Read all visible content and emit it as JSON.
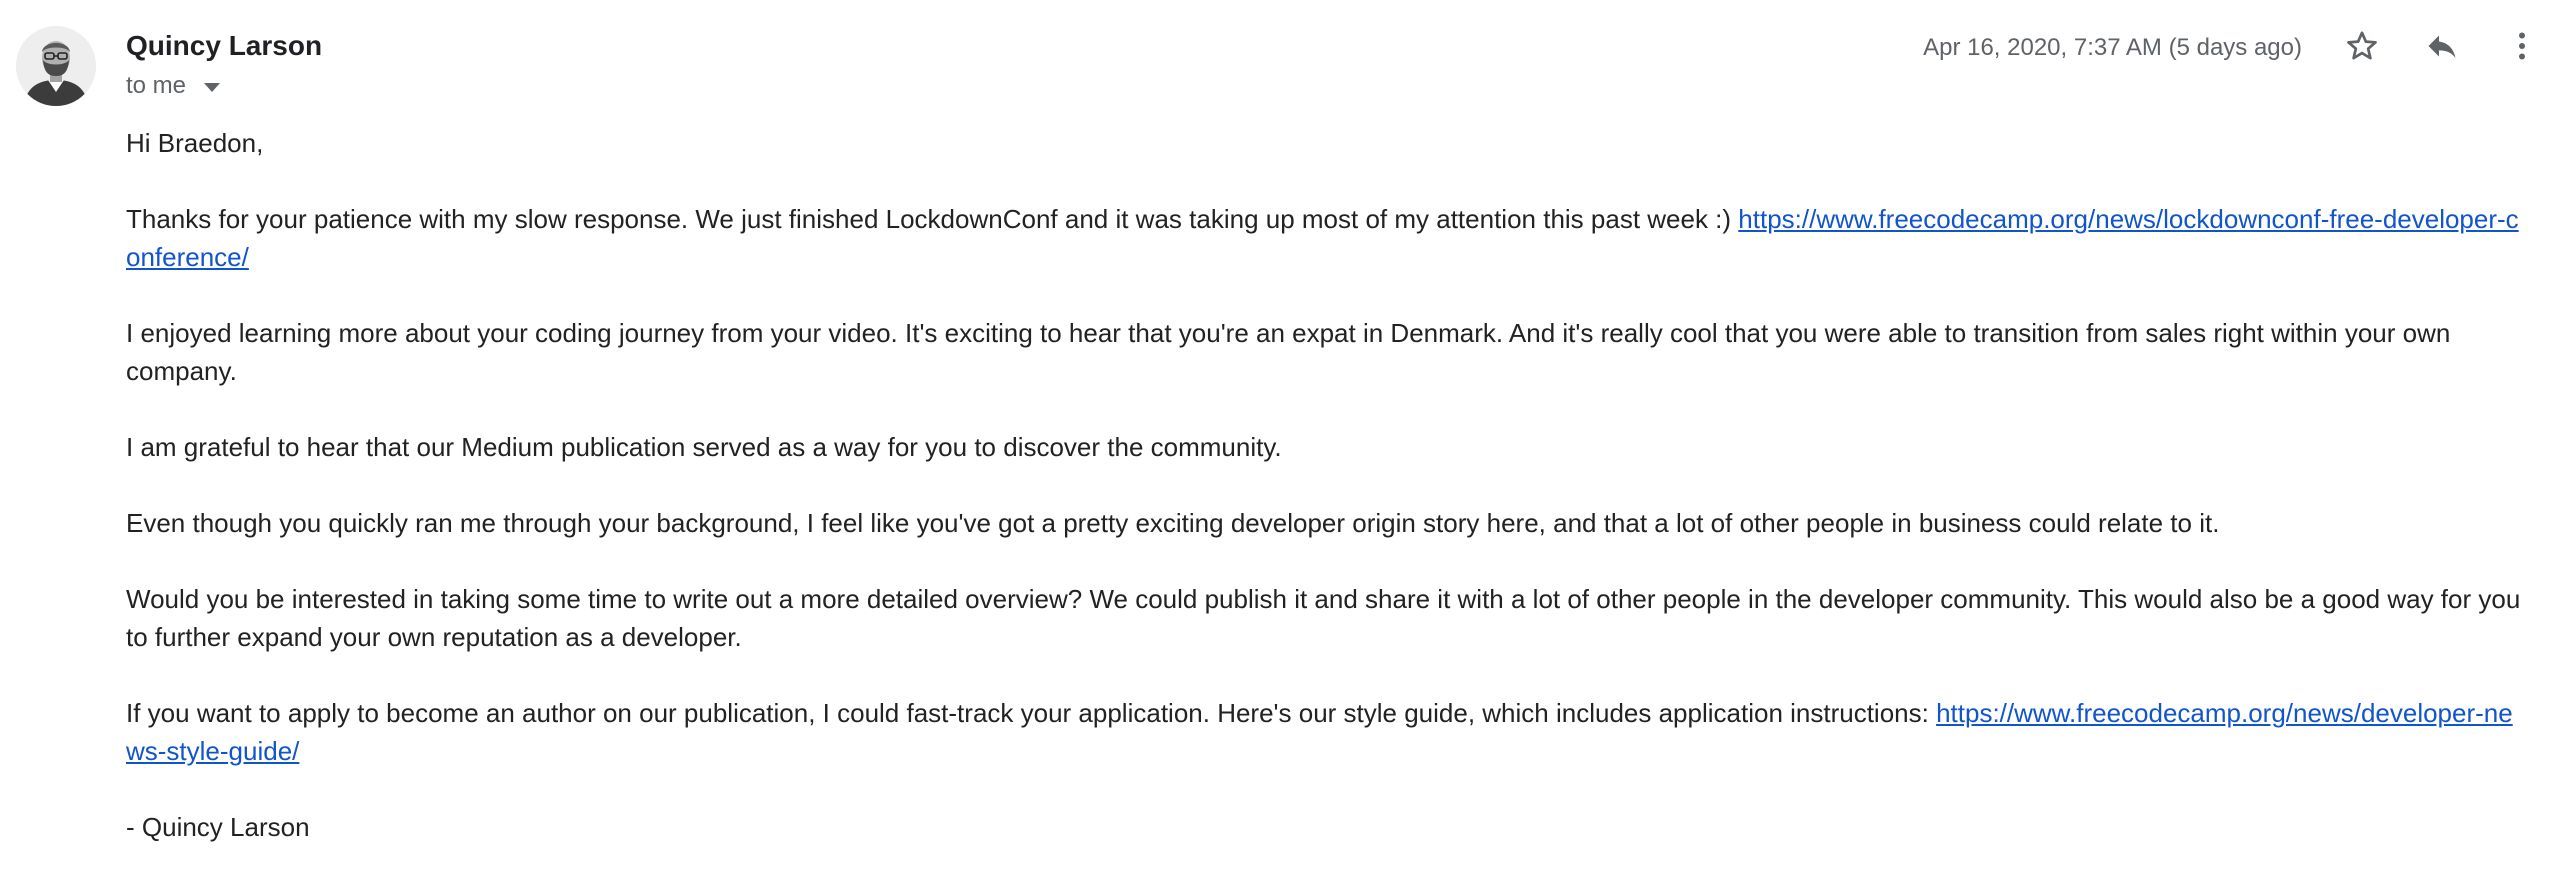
{
  "header": {
    "sender_name": "Quincy Larson",
    "recipient": "to me",
    "date": "Apr 16, 2020, 7:37 AM (5 days ago)",
    "icons": {
      "avatar": "sender-avatar",
      "star": "star-icon",
      "reply": "reply-icon",
      "more": "more-vert-icon",
      "dropdown": "caret-down-icon"
    }
  },
  "body": {
    "greeting": "Hi Braedon,",
    "p1_text": "Thanks for your patience with my slow response. We just finished LockdownConf and it was taking up most of my attention this past week :) ",
    "p1_link": "https://www.freecodecamp.org/news/lockdownconf-free-developer-conference/",
    "p2": "I enjoyed learning more about your coding journey from your video. It's exciting to hear that you're an expat in Denmark. And it's really cool that you were able to transition from sales right within your own company.",
    "p3": "I am grateful to hear that our Medium publication served as a way for you to discover the community.",
    "p4": "Even though you quickly ran me through your background, I feel like you've got a pretty exciting developer origin story here, and that a lot of other people in business could relate to it.",
    "p5": "Would you be interested in taking some time to write out a more detailed overview? We could publish it and share it with a lot of other people in the developer community. This would also be a good way for you to further expand your own reputation as a developer.",
    "p6_text": "If you want to apply to become an author on our publication, I could fast-track your application. Here's our style guide, which includes application instructions: ",
    "p6_link": "https://www.freecodecamp.org/news/developer-news-style-guide/",
    "signature": "- Quincy Larson"
  },
  "colors": {
    "link": "#1155cc",
    "secondary_text": "#5f6368",
    "body_text": "#222222"
  }
}
